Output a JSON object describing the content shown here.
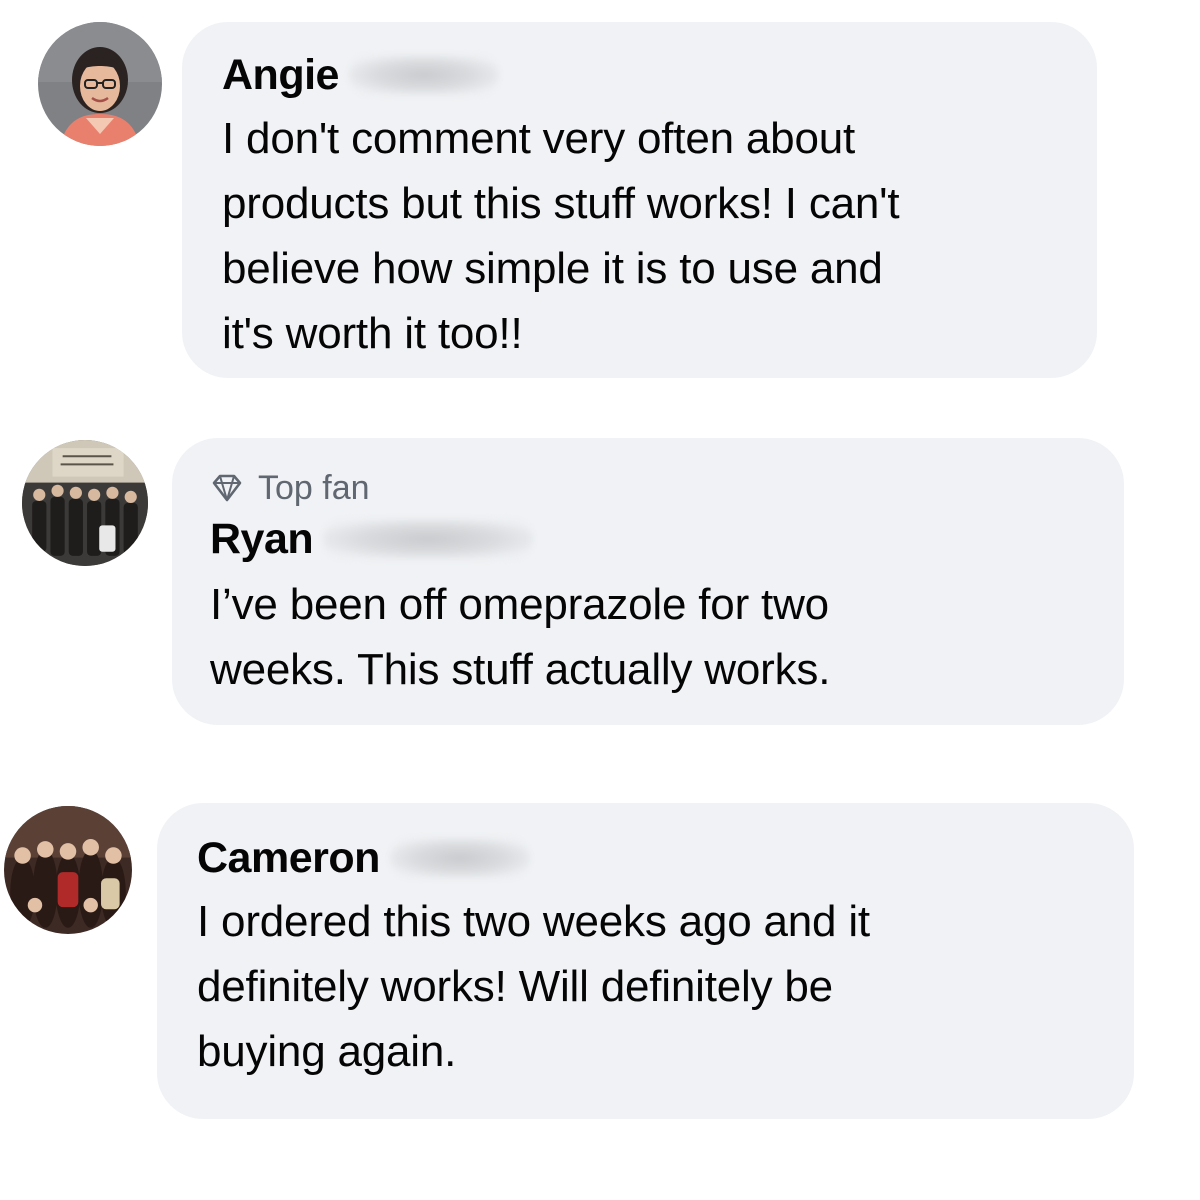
{
  "comments": [
    {
      "author": "Angie",
      "avatar_icon": "profile-photo-woman",
      "badge": null,
      "text_lines": [
        "I don't comment very often about",
        "products but this stuff works! I can't",
        "believe how simple it is to use and",
        "it's worth it too!!"
      ]
    },
    {
      "author": "Ryan",
      "avatar_icon": "profile-photo-group",
      "badge": {
        "label": "Top fan",
        "icon": "diamond-icon"
      },
      "text_lines": [
        "I’ve been off omeprazole for two",
        "weeks. This stuff actually works."
      ]
    },
    {
      "author": "Cameron",
      "avatar_icon": "profile-photo-group",
      "badge": null,
      "text_lines": [
        "I ordered this two weeks ago and it",
        "definitely works! Will definitely be",
        "buying again."
      ]
    }
  ],
  "colors": {
    "bubble": "#f0f2f5",
    "text": "#050505",
    "badge_text": "#606770"
  }
}
